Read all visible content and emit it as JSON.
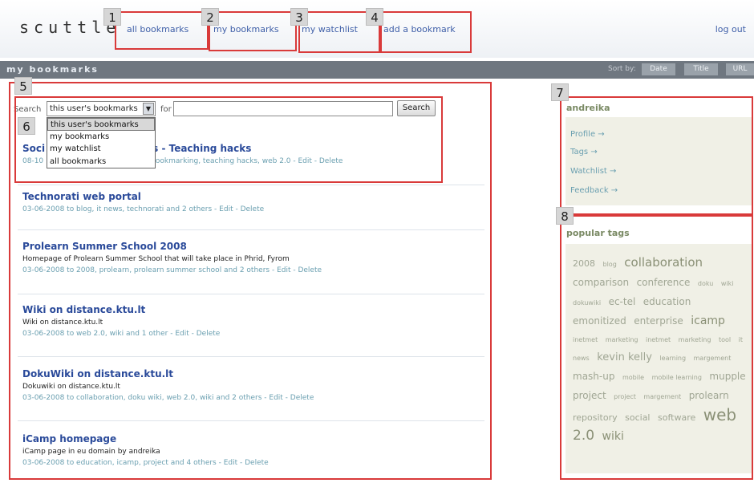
{
  "header": {
    "logo": "scuttle",
    "nav": [
      {
        "label": "all bookmarks"
      },
      {
        "label": "my bookmarks"
      },
      {
        "label": "my watchlist"
      },
      {
        "label": "add a bookmark"
      }
    ],
    "logout": "log out"
  },
  "titlebar": {
    "title": "my bookmarks",
    "sort_label": "Sort by:",
    "sort_buttons": [
      "Date",
      "Title",
      "URL"
    ]
  },
  "annotations": [
    "1",
    "2",
    "3",
    "4",
    "5",
    "6",
    "7",
    "8"
  ],
  "search": {
    "label": "Search",
    "selected": "this user's bookmarks",
    "for_label": "for",
    "input_value": "",
    "button": "Search",
    "options": [
      "this user's bookmarks",
      "my bookmarks",
      "my watchlist",
      "all bookmarks"
    ]
  },
  "bookmarks": [
    {
      "title_left": "Soci",
      "title_right": "s - Teaching hacks",
      "desc": "",
      "meta_left": "08-10",
      "meta_right": "bookmarking, teaching hacks, web 2.0 - Edit - Delete"
    },
    {
      "title": "Technorati web portal",
      "desc": "",
      "meta": "03-06-2008 to blog, it news, technorati and 2 others - Edit - Delete"
    },
    {
      "title": "Prolearn Summer School 2008",
      "desc": "Homepage of Prolearn Summer School that will take place in Phrid, Fyrom",
      "meta": "03-06-2008 to 2008, prolearn, prolearn summer school and 2 others - Edit - Delete"
    },
    {
      "title": "Wiki on distance.ktu.lt",
      "desc": "Wiki on distance.ktu.lt",
      "meta": "03-06-2008 to web 2.0, wiki and 1 other - Edit - Delete"
    },
    {
      "title": "DokuWiki on distance.ktu.lt",
      "desc": "Dokuwiki on distance.ktu.lt",
      "meta": "03-06-2008 to collaboration, doku wiki, web 2.0, wiki and 2 others - Edit - Delete"
    },
    {
      "title": "iCamp homepage",
      "desc": "iCamp page in eu domain by andreika",
      "meta": "03-06-2008 to education, icamp, project and 4 others - Edit - Delete"
    }
  ],
  "sidebar": {
    "user": "andreika",
    "links": [
      "Profile →",
      "Tags →",
      "Watchlist →",
      "Feedback →"
    ],
    "tags_title": "popular tags",
    "tags": [
      {
        "t": "2008",
        "s": 11
      },
      {
        "t": "blog",
        "s": 8
      },
      {
        "t": "collaboration",
        "s": 15
      },
      {
        "t": "comparison",
        "s": 12
      },
      {
        "t": "conference",
        "s": 12
      },
      {
        "t": "doku",
        "s": 8
      },
      {
        "t": "wiki",
        "s": 8
      },
      {
        "t": "dokuwiki",
        "s": 8
      },
      {
        "t": "ec-tel",
        "s": 12
      },
      {
        "t": "education",
        "s": 12
      },
      {
        "t": "emonitized",
        "s": 12
      },
      {
        "t": "enterprise",
        "s": 12
      },
      {
        "t": "icamp",
        "s": 14
      },
      {
        "t": "inetmet",
        "s": 8
      },
      {
        "t": "marketing",
        "s": 8
      },
      {
        "t": "inetmet",
        "s": 8
      },
      {
        "t": "marketing",
        "s": 8
      },
      {
        "t": "tool",
        "s": 8
      },
      {
        "t": "it",
        "s": 8
      },
      {
        "t": "news",
        "s": 8
      },
      {
        "t": "kevin kelly",
        "s": 13
      },
      {
        "t": "learning",
        "s": 8
      },
      {
        "t": "margement",
        "s": 8
      },
      {
        "t": "mash-up",
        "s": 12
      },
      {
        "t": "mobile",
        "s": 8
      },
      {
        "t": "mobile learning",
        "s": 8
      },
      {
        "t": "mupple",
        "s": 12
      },
      {
        "t": "project",
        "s": 12
      },
      {
        "t": "project",
        "s": 8
      },
      {
        "t": "margement",
        "s": 8
      },
      {
        "t": "prolearn",
        "s": 12
      },
      {
        "t": "repository",
        "s": 11
      },
      {
        "t": "social",
        "s": 11
      },
      {
        "t": "software",
        "s": 11
      },
      {
        "t": "web",
        "s": 20
      },
      {
        "t": "2.0",
        "s": 17
      },
      {
        "t": "wiki",
        "s": 14
      }
    ]
  },
  "colors": {
    "annotation": "#d93a3a",
    "link": "#3f5fa8",
    "titlebar": "#6f7780",
    "meta": "#6a9fb0"
  }
}
